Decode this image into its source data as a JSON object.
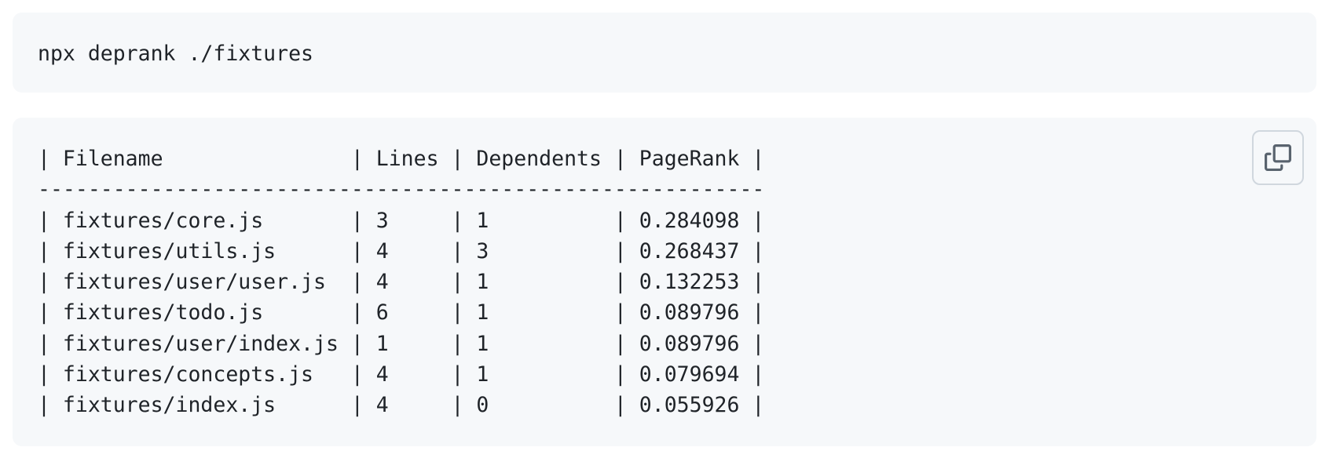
{
  "command": {
    "text": "npx deprank ./fixtures"
  },
  "output": {
    "lines": [
      "| Filename               | Lines | Dependents | PageRank |",
      "----------------------------------------------------------",
      "| fixtures/core.js       | 3     | 1          | 0.284098 |",
      "| fixtures/utils.js      | 4     | 3          | 0.268437 |",
      "| fixtures/user/user.js  | 4     | 1          | 0.132253 |",
      "| fixtures/todo.js       | 6     | 1          | 0.089796 |",
      "| fixtures/user/index.js | 1     | 1          | 0.089796 |",
      "| fixtures/concepts.js   | 4     | 1          | 0.079694 |",
      "| fixtures/index.js      | 4     | 0          | 0.055926 |"
    ]
  },
  "copy_button": {
    "icon": "copy-icon"
  },
  "colors": {
    "code_background": "#f6f8fa",
    "text": "#1f2328",
    "button_border": "#d0d7de",
    "icon": "#59636e"
  }
}
